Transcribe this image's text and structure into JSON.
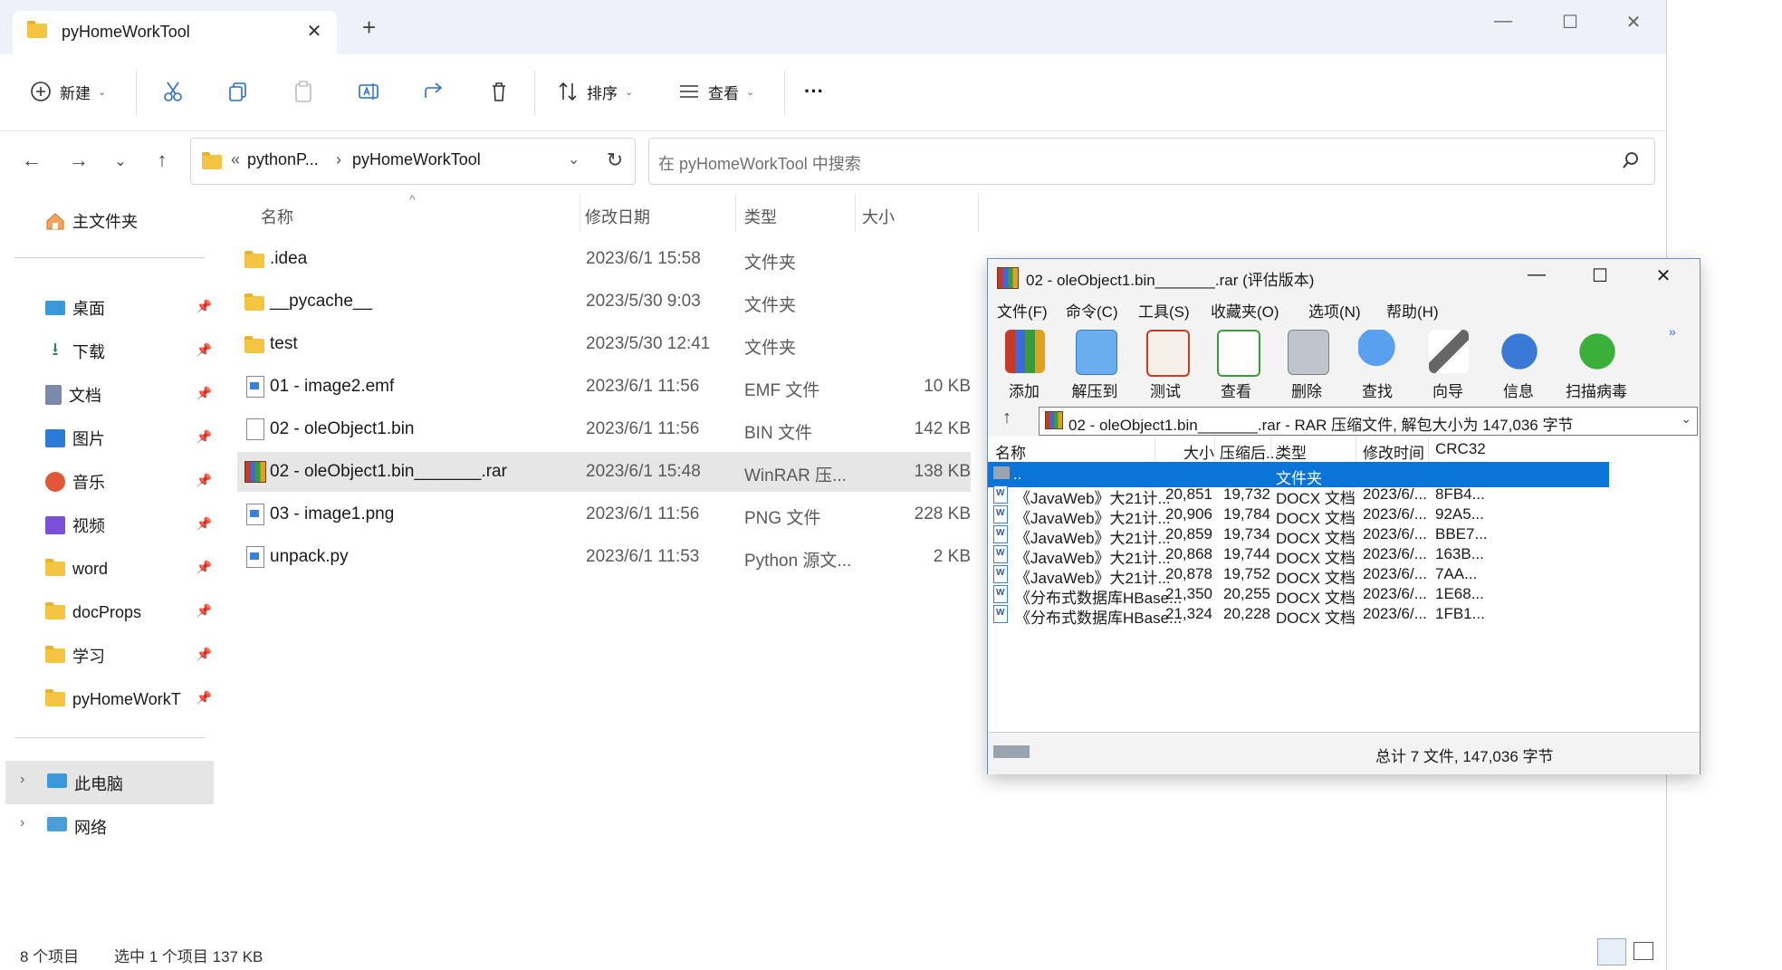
{
  "explorer": {
    "tab_title": "pyHomeWorkTool",
    "tab_close": "✕",
    "new_tab": "+",
    "window_controls": {
      "minimize": "—",
      "maximize": "☐",
      "close": "✕"
    },
    "toolbar": {
      "new_label": "新建",
      "sort_label": "排序",
      "view_label": "查看",
      "more_label": "···"
    },
    "address": {
      "crumb_prefix": "«",
      "crumb_1": "pythonP...",
      "separator": "›",
      "crumb_2": "pyHomeWorkTool"
    },
    "search": {
      "placeholder": "在 pyHomeWorkTool 中搜索"
    },
    "nav": {
      "home": "主文件夹",
      "pinned": [
        {
          "label": "桌面"
        },
        {
          "label": "下载"
        },
        {
          "label": "文档"
        },
        {
          "label": "图片"
        },
        {
          "label": "音乐"
        },
        {
          "label": "视频"
        },
        {
          "label": "word"
        },
        {
          "label": "docProps"
        },
        {
          "label": "学习"
        },
        {
          "label": "pyHomeWorkT"
        }
      ],
      "this_pc": "此电脑",
      "network": "网络"
    },
    "columns": {
      "name": "名称",
      "date": "修改日期",
      "type": "类型",
      "size": "大小"
    },
    "files": [
      {
        "name": ".idea",
        "date": "2023/6/1 15:58",
        "type": "文件夹",
        "size": ""
      },
      {
        "name": "__pycache__",
        "date": "2023/5/30 9:03",
        "type": "文件夹",
        "size": ""
      },
      {
        "name": "test",
        "date": "2023/5/30 12:41",
        "type": "文件夹",
        "size": ""
      },
      {
        "name": "01 - image2.emf",
        "date": "2023/6/1 11:56",
        "type": "EMF 文件",
        "size": "10 KB"
      },
      {
        "name": "02 - oleObject1.bin",
        "date": "2023/6/1 11:56",
        "type": "BIN 文件",
        "size": "142 KB"
      },
      {
        "name": "02 - oleObject1.bin_______.rar",
        "date": "2023/6/1 15:48",
        "type": "WinRAR 压...",
        "size": "138 KB"
      },
      {
        "name": "03 - image1.png",
        "date": "2023/6/1 11:56",
        "type": "PNG 文件",
        "size": "228 KB"
      },
      {
        "name": "unpack.py",
        "date": "2023/6/1 11:53",
        "type": "Python 源文...",
        "size": "2 KB"
      }
    ],
    "status": {
      "count": "8 个项目",
      "selection": "选中 1 个项目  137 KB"
    }
  },
  "winrar": {
    "title": "02 - oleObject1.bin_______.rar (评估版本)",
    "window_controls": {
      "minimize": "—",
      "maximize": "☐",
      "close": "✕"
    },
    "menu": [
      "文件(F)",
      "命令(C)",
      "工具(S)",
      "收藏夹(O)",
      "选项(N)",
      "帮助(H)"
    ],
    "tools": [
      "添加",
      "解压到",
      "测试",
      "查看",
      "删除",
      "查找",
      "向导",
      "信息",
      "扫描病毒"
    ],
    "path_text": "02 - oleObject1.bin_______.rar - RAR 压缩文件, 解包大小为 147,036 字节",
    "columns": {
      "name": "名称",
      "size": "大小",
      "packed": "压缩后...",
      "type": "类型",
      "modified": "修改时间",
      "crc": "CRC32"
    },
    "parent_row": {
      "name": "..",
      "type": "文件夹"
    },
    "rows": [
      {
        "name": "《JavaWeb》大21计...",
        "size": "20,851",
        "packed": "19,732",
        "type": "DOCX 文档",
        "modified": "2023/6/...",
        "crc": "8FB4..."
      },
      {
        "name": "《JavaWeb》大21计...",
        "size": "20,906",
        "packed": "19,784",
        "type": "DOCX 文档",
        "modified": "2023/6/...",
        "crc": "92A5..."
      },
      {
        "name": "《JavaWeb》大21计...",
        "size": "20,859",
        "packed": "19,734",
        "type": "DOCX 文档",
        "modified": "2023/6/...",
        "crc": "BBE7..."
      },
      {
        "name": "《JavaWeb》大21计...",
        "size": "20,868",
        "packed": "19,744",
        "type": "DOCX 文档",
        "modified": "2023/6/...",
        "crc": "163B..."
      },
      {
        "name": "《JavaWeb》大21计...",
        "size": "20,878",
        "packed": "19,752",
        "type": "DOCX 文档",
        "modified": "2023/6/...",
        "crc": "7AA..."
      },
      {
        "name": "《分布式数据库HBase...",
        "size": "21,350",
        "packed": "20,255",
        "type": "DOCX 文档",
        "modified": "2023/6/...",
        "crc": "1E68..."
      },
      {
        "name": "《分布式数据库HBase...",
        "size": "21,324",
        "packed": "20,228",
        "type": "DOCX 文档",
        "modified": "2023/6/...",
        "crc": "1FB1..."
      }
    ],
    "status": "总计 7 文件, 147,036 字节",
    "colors": {
      "selection": "#0a74d9"
    }
  }
}
